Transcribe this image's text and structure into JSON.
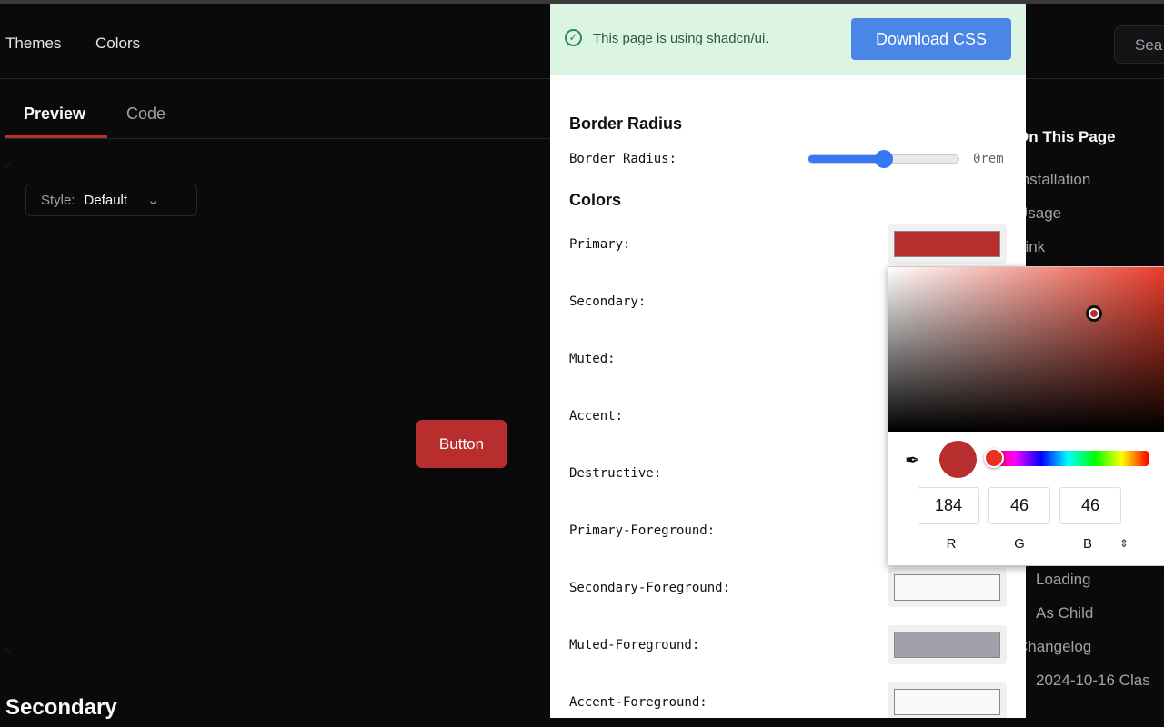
{
  "header": {
    "nav": [
      "Themes",
      "Colors"
    ],
    "search_placeholder": "Sea"
  },
  "tabs": [
    "Preview",
    "Code"
  ],
  "preview": {
    "style_label": "Style:",
    "style_value": "Default",
    "button_label": "Button"
  },
  "section_heading": "Secondary",
  "toc": {
    "title": "On This Page",
    "items": [
      "Installation",
      "Usage",
      "Link",
      "Loading",
      "As Child",
      "Changelog",
      "2024-10-16 Clas"
    ]
  },
  "panel": {
    "banner_text": "This page is using shadcn/ui.",
    "download_label": "Download CSS",
    "border_radius_heading": "Border Radius",
    "border_radius_label": "Border Radius:",
    "border_radius_value": "0rem",
    "border_radius_slider_fraction": 0.5,
    "colors_heading": "Colors",
    "colors": [
      {
        "label": "Primary:",
        "value": "#b82e2e"
      },
      {
        "label": "Secondary:"
      },
      {
        "label": "Muted:"
      },
      {
        "label": "Accent:"
      },
      {
        "label": "Destructive:"
      },
      {
        "label": "Primary-Foreground:"
      },
      {
        "label": "Secondary-Foreground:",
        "value": "#fafafa"
      },
      {
        "label": "Muted-Foreground:",
        "value": "#a1a1aa"
      },
      {
        "label": "Accent-Foreground:",
        "value": "#fafafa"
      }
    ]
  },
  "picker": {
    "r": "184",
    "g": "46",
    "b": "46",
    "labels": [
      "R",
      "G",
      "B"
    ],
    "color": "#b82e2e"
  }
}
